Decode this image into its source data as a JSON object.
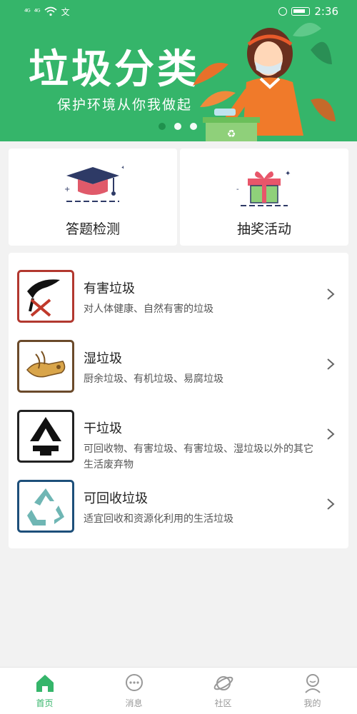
{
  "status_bar": {
    "signal_left": "⁴ᴳ",
    "signal_right": "⁴ᴳ",
    "extra": "文",
    "time": "2:36"
  },
  "banner": {
    "title": "垃圾分类",
    "subtitle": "保护环境从你我做起",
    "carousel_active_index": 0,
    "carousel_count": 3
  },
  "cards": [
    {
      "label": "答题检测",
      "icon": "graduation-cap-icon"
    },
    {
      "label": "抽奖活动",
      "icon": "gift-box-icon"
    }
  ],
  "categories": [
    {
      "title": "有害垃圾",
      "desc": "对人体健康、自然有害的垃圾",
      "icon": "hazardous-waste-icon",
      "color": "#b2382f"
    },
    {
      "title": "湿垃圾",
      "desc": "厨余垃圾、有机垃圾、易腐垃圾",
      "icon": "wet-waste-icon",
      "color": "#6b4a2a"
    },
    {
      "title": "干垃圾",
      "desc": "可回收物、有害垃圾、有害垃圾、湿垃圾以外的其它生活废弃物",
      "icon": "dry-waste-icon",
      "color": "#222222"
    },
    {
      "title": "可回收垃圾",
      "desc": "适宜回收和资源化利用的生活垃圾",
      "icon": "recyclable-icon",
      "color": "#1d4f7a"
    }
  ],
  "tabs": [
    {
      "label": "首页",
      "icon": "home-icon",
      "active": true
    },
    {
      "label": "消息",
      "icon": "message-icon",
      "active": false
    },
    {
      "label": "社区",
      "icon": "planet-icon",
      "active": false
    },
    {
      "label": "我的",
      "icon": "profile-icon",
      "active": false
    }
  ],
  "colors": {
    "accent": "#35b56a",
    "background": "#f2f2f2"
  }
}
